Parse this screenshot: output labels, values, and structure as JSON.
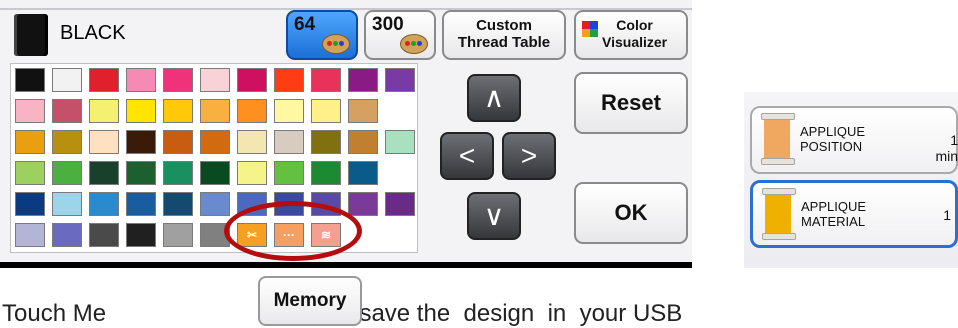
{
  "thread": {
    "name": "BLACK",
    "color": "#111111"
  },
  "palette_buttons": [
    {
      "label": "64",
      "selected": true
    },
    {
      "label": "300",
      "selected": false
    }
  ],
  "custom_table": {
    "label_line1": "Custom",
    "label_line2": "Thread Table"
  },
  "visualizer": {
    "label_line1": "Color",
    "label_line2": "Visualizer"
  },
  "actions": {
    "reset": "Reset",
    "ok": "OK"
  },
  "navigation": {
    "up": "∧",
    "left": "<",
    "right": ">",
    "down": "∨"
  },
  "colors": [
    [
      "#111111",
      "#f2f2f2",
      "#e0202a",
      "#f58bb4",
      "#f0327a",
      "#f9d2d8",
      "#cf1060",
      "#ff3c14",
      "#e8325a",
      "#8a1a84",
      "#7a3aa6"
    ],
    [
      "#f8b4c4",
      "#c4506a",
      "#f4f070",
      "#ffe400",
      "#ffc90a",
      "#f8b040",
      "#ff9020",
      "#fff8a0",
      "#fff08a",
      "#d6a060",
      null
    ],
    [
      "#e8a010",
      "#b89010",
      "#ffe0c0",
      "#3a1a08",
      "#c85c10",
      "#d26a10",
      "#f4e6b0",
      "#d8ccc0",
      "#807010",
      "#c08030",
      "#a8e0c0"
    ],
    [
      "#9cd060",
      "#4cb040",
      "#18402a",
      "#1c6030",
      "#1a9060",
      "#0a4a20",
      "#f4f48a",
      "#64c040",
      "#1c8a30",
      "#0a5a8a",
      null
    ],
    [
      "#0a3a80",
      "#9cd4ea",
      "#2a8ad0",
      "#1a5ca0",
      "#144a70",
      "#6a8ad0",
      "#4a6ac0",
      "#3a4aa0",
      "#5a4aa8",
      "#7a3a9a",
      "#6a2a88"
    ],
    [
      "#b4b4d4",
      "#6a6ac0",
      "#4a4a4a",
      "#202020",
      "#a0a0a0",
      "#808080",
      "#f5a020",
      "#f5a060",
      "#f4a090",
      null,
      null
    ]
  ],
  "special_cells": [
    "scissors-icon",
    "dots-icon",
    "zigzag-icon"
  ],
  "applique": [
    {
      "line1": "APPLIQUE",
      "line2": "POSITION",
      "value": "1",
      "unit": "min",
      "color": "#f0a860"
    },
    {
      "line1": "APPLIQUE",
      "line2": "MATERIAL",
      "value": "1",
      "unit": "",
      "color": "#f0b000"
    }
  ],
  "memory_button": "Memory",
  "caption": "Touch Me                                 to  save the  design  in  your USB"
}
